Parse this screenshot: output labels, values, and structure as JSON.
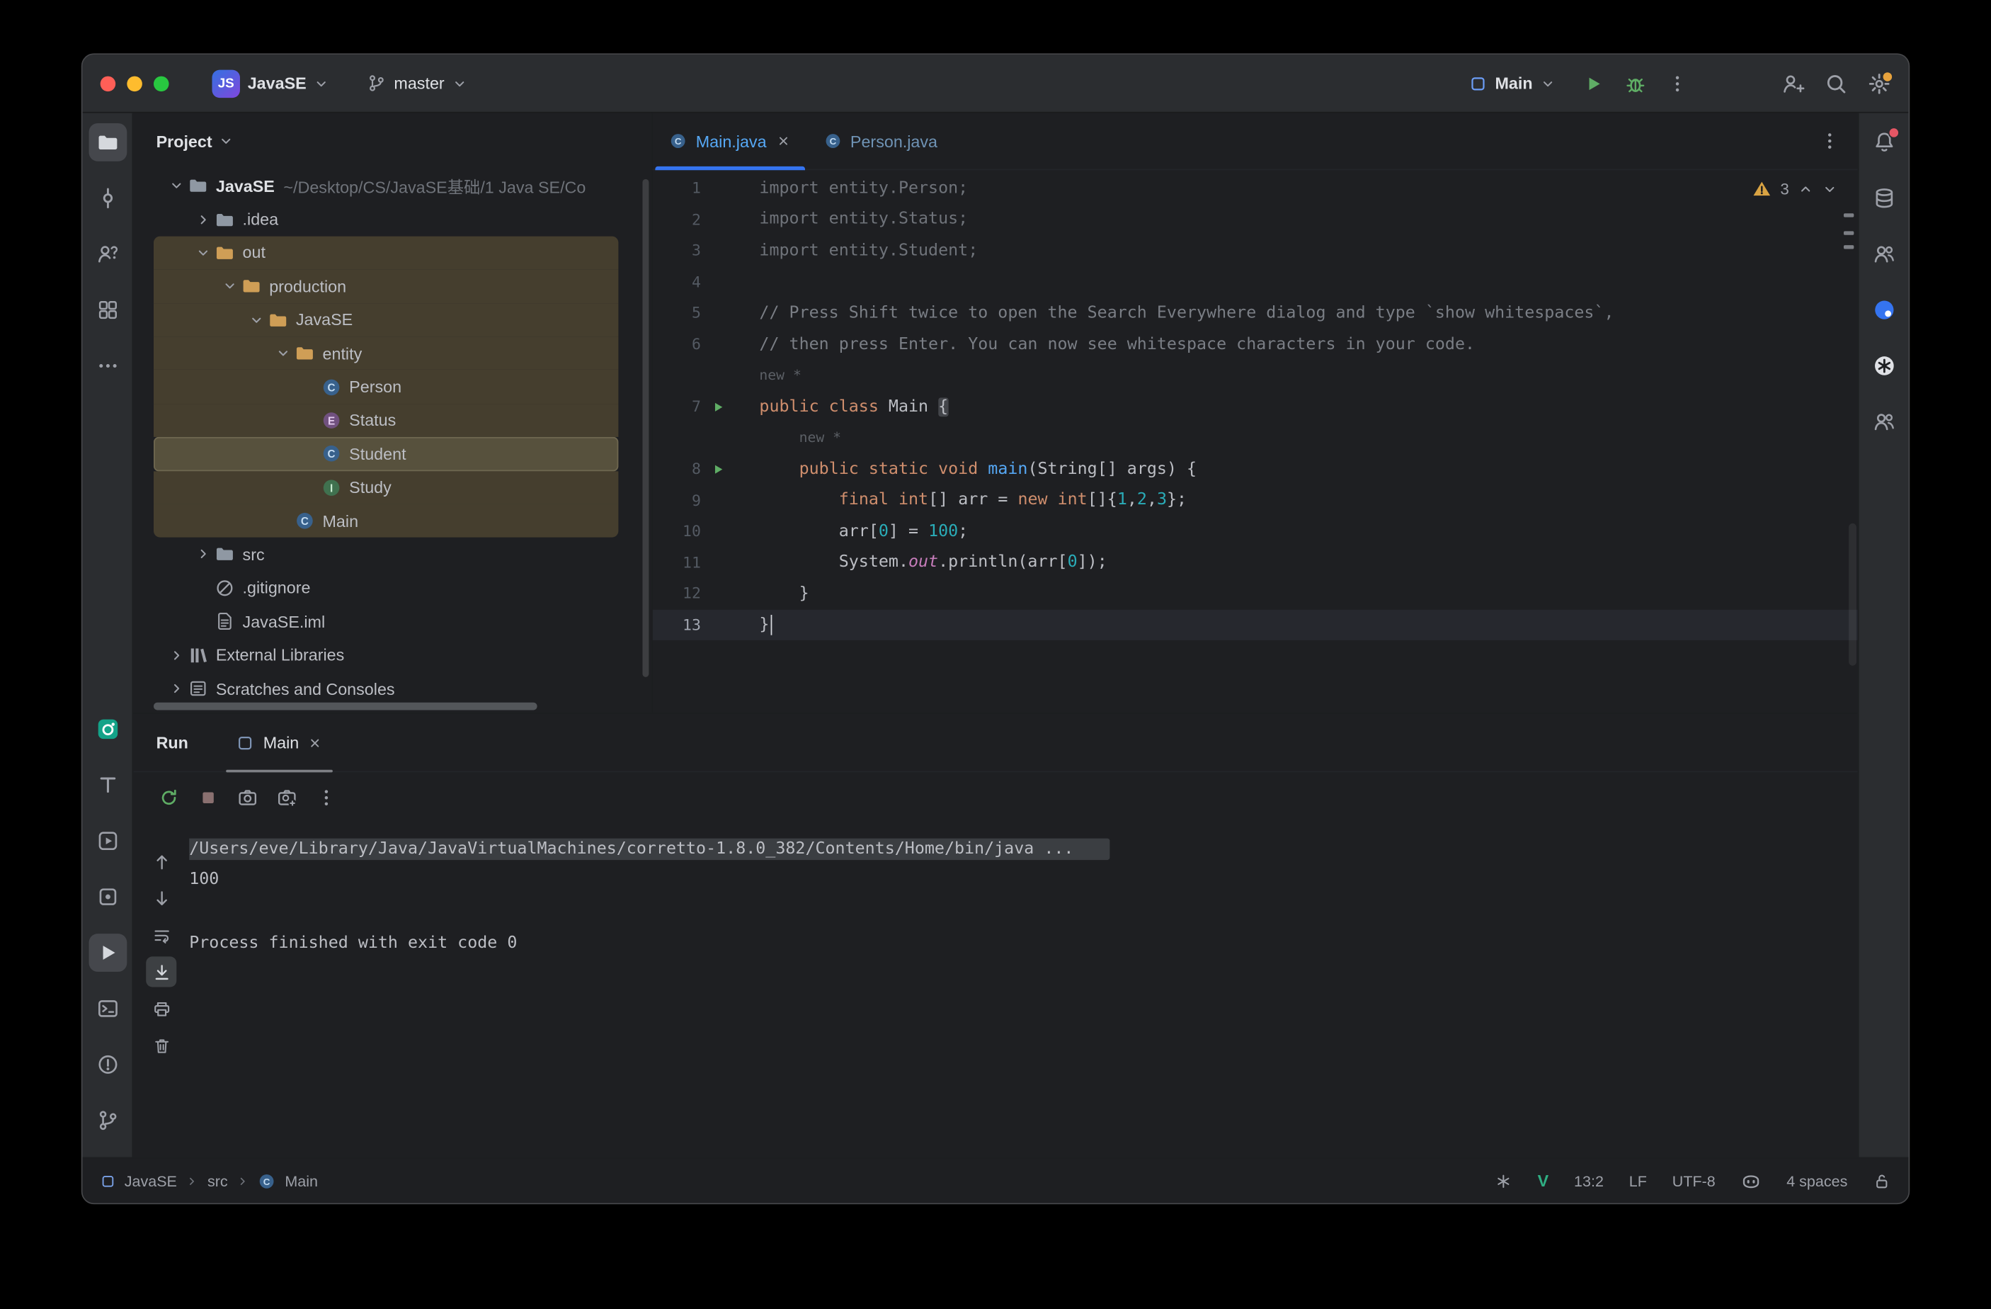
{
  "titlebar": {
    "badge": "JS",
    "project": "JavaSE",
    "branch": "master",
    "run_config": "Main"
  },
  "left_strip": {
    "top": [
      {
        "name": "project",
        "icon": "folder",
        "selected": true
      },
      {
        "name": "commit",
        "icon": "commit"
      },
      {
        "name": "collaboration",
        "icon": "collab"
      },
      {
        "name": "structure",
        "icon": "structure"
      },
      {
        "name": "more-tools",
        "icon": "ellipsis"
      }
    ],
    "bottom": [
      {
        "name": "ai-plugin",
        "icon": "ai-plugin"
      },
      {
        "name": "todo",
        "icon": "todo"
      },
      {
        "name": "services",
        "icon": "services"
      },
      {
        "name": "build",
        "icon": "build"
      },
      {
        "name": "run",
        "icon": "play",
        "selected": true
      },
      {
        "name": "terminal",
        "icon": "terminal"
      },
      {
        "name": "problems",
        "icon": "problems"
      },
      {
        "name": "git",
        "icon": "branch"
      }
    ]
  },
  "right_strip": {
    "icons": [
      {
        "name": "notifications",
        "icon": "bell",
        "badge": true
      },
      {
        "name": "database",
        "icon": "database"
      },
      {
        "name": "ai-assistant",
        "icon": "users"
      },
      {
        "name": "chat",
        "icon": "chat"
      },
      {
        "name": "openai",
        "icon": "openai"
      },
      {
        "name": "collaboration-2",
        "icon": "users"
      }
    ]
  },
  "project_panel": {
    "header": "Project",
    "tree": [
      {
        "label": "JavaSE",
        "suffix": "~/Desktop/CS/JavaSE基础/1 Java SE/Co",
        "indent": 0,
        "chevron": "down",
        "icon": "folder-project",
        "bold": true
      },
      {
        "label": ".idea",
        "indent": 1,
        "chevron": "right",
        "icon": "folder"
      },
      {
        "label": "out",
        "indent": 1,
        "chevron": "down",
        "icon": "folder-excluded",
        "hl": true
      },
      {
        "label": "production",
        "indent": 2,
        "chevron": "down",
        "icon": "folder-excluded",
        "hl": true
      },
      {
        "label": "JavaSE",
        "indent": 3,
        "chevron": "down",
        "icon": "folder-excluded",
        "hl": true
      },
      {
        "label": "entity",
        "indent": 4,
        "chevron": "down",
        "icon": "folder-excluded",
        "hl": true
      },
      {
        "label": "Person",
        "indent": 5,
        "icon": "class",
        "hl": true
      },
      {
        "label": "Status",
        "indent": 5,
        "icon": "enum",
        "hl": true
      },
      {
        "label": "Student",
        "indent": 5,
        "icon": "class",
        "hl": true,
        "selected": true
      },
      {
        "label": "Study",
        "indent": 5,
        "icon": "interface",
        "hl": true
      },
      {
        "label": "Main",
        "indent": 4,
        "icon": "class",
        "hl": true
      },
      {
        "label": "src",
        "indent": 1,
        "chevron": "right",
        "icon": "folder"
      },
      {
        "label": ".gitignore",
        "indent": 1,
        "icon": "gitignore"
      },
      {
        "label": "JavaSE.iml",
        "indent": 1,
        "icon": "file"
      },
      {
        "label": "External Libraries",
        "indent": 0,
        "chevron": "right",
        "icon": "libraries"
      },
      {
        "label": "Scratches and Consoles",
        "indent": 0,
        "chevron": "right",
        "icon": "scratches"
      }
    ]
  },
  "editor": {
    "tabs": [
      {
        "label": "Main.java",
        "active": true
      },
      {
        "label": "Person.java",
        "active": false
      }
    ],
    "warning_count": "3",
    "lines": [
      {
        "n": "1",
        "segs": [
          {
            "t": "import entity.Person;",
            "c": "unused"
          }
        ]
      },
      {
        "n": "2",
        "segs": [
          {
            "t": "import entity.Status;",
            "c": "unused"
          }
        ]
      },
      {
        "n": "3",
        "segs": [
          {
            "t": "import entity.Student;",
            "c": "unused"
          }
        ]
      },
      {
        "n": "4",
        "segs": []
      },
      {
        "n": "5",
        "segs": [
          {
            "t": "// Press Shift twice to open the Search Everywhere dialog and type `show whitespaces`,",
            "c": "comment"
          }
        ]
      },
      {
        "n": "6",
        "segs": [
          {
            "t": "// then press Enter. You can now see whitespace characters in your code.",
            "c": "comment"
          }
        ]
      },
      {
        "inlay": "new *",
        "pad": 0
      },
      {
        "n": "7",
        "run": true,
        "segs": [
          {
            "t": "public class ",
            "c": "kw"
          },
          {
            "t": "Main ",
            "c": "plain"
          },
          {
            "t": "{",
            "c": "plain",
            "hl": true
          }
        ]
      },
      {
        "inlay": "new *",
        "pad": 4
      },
      {
        "n": "8",
        "run": true,
        "segs": [
          {
            "t": "    ",
            "c": "plain"
          },
          {
            "t": "public static void ",
            "c": "kw"
          },
          {
            "t": "main",
            "c": "method"
          },
          {
            "t": "(String[] args) {",
            "c": "plain"
          }
        ]
      },
      {
        "n": "9",
        "segs": [
          {
            "t": "        ",
            "c": "plain"
          },
          {
            "t": "final int",
            "c": "kw"
          },
          {
            "t": "[] arr = ",
            "c": "plain"
          },
          {
            "t": "new int",
            "c": "kw"
          },
          {
            "t": "[]{",
            "c": "plain"
          },
          {
            "t": "1",
            "c": "num"
          },
          {
            "t": ",",
            "c": "plain"
          },
          {
            "t": "2",
            "c": "num"
          },
          {
            "t": ",",
            "c": "plain"
          },
          {
            "t": "3",
            "c": "num"
          },
          {
            "t": "};",
            "c": "plain"
          }
        ]
      },
      {
        "n": "10",
        "segs": [
          {
            "t": "        arr[",
            "c": "plain"
          },
          {
            "t": "0",
            "c": "num"
          },
          {
            "t": "] = ",
            "c": "plain"
          },
          {
            "t": "100",
            "c": "num"
          },
          {
            "t": ";",
            "c": "plain"
          }
        ]
      },
      {
        "n": "11",
        "segs": [
          {
            "t": "        System.",
            "c": "plain"
          },
          {
            "t": "out",
            "c": "field"
          },
          {
            "t": ".println(arr[",
            "c": "plain"
          },
          {
            "t": "0",
            "c": "num"
          },
          {
            "t": "]);",
            "c": "plain"
          }
        ]
      },
      {
        "n": "12",
        "segs": [
          {
            "t": "    }",
            "c": "plain"
          }
        ]
      },
      {
        "n": "13",
        "current": true,
        "caret": true,
        "segs": [
          {
            "t": "}",
            "c": "plain"
          }
        ]
      }
    ]
  },
  "run_panel": {
    "title": "Run",
    "tab": "Main",
    "toolbar_icons": [
      {
        "name": "rerun",
        "icon": "rerun",
        "cls": "c-green"
      },
      {
        "name": "stop",
        "icon": "stop",
        "cls": "rt-stop"
      },
      {
        "name": "screenshot",
        "icon": "screenshot"
      },
      {
        "name": "screenshot-edit",
        "icon": "screenshot-edit"
      },
      {
        "name": "more-options",
        "icon": "kebab"
      }
    ],
    "side_icons": [
      {
        "name": "scroll-up",
        "icon": "arrow-up"
      },
      {
        "name": "scroll-down",
        "icon": "arrow-down"
      },
      {
        "name": "soft-wrap",
        "icon": "soft-wrap"
      },
      {
        "name": "scroll-to-end",
        "icon": "scroll-end",
        "selected": true
      },
      {
        "name": "print",
        "icon": "print"
      },
      {
        "name": "clear-all",
        "icon": "clear"
      }
    ],
    "console": [
      {
        "text": "/Users/eve/Library/Java/JavaVirtualMachines/corretto-1.8.0_382/Contents/Home/bin/java ...",
        "selected": true
      },
      {
        "text": "100"
      },
      {
        "text": ""
      },
      {
        "text": "Process finished with exit code 0"
      }
    ]
  },
  "statusbar": {
    "breadcrumbs": [
      {
        "label": "JavaSE",
        "icon": "module"
      },
      {
        "label": "src"
      },
      {
        "label": "Main",
        "icon": "class"
      }
    ],
    "v_badge": "V",
    "caret": "13:2",
    "line_sep": "LF",
    "encoding": "UTF-8",
    "indent": "4 spaces"
  }
}
